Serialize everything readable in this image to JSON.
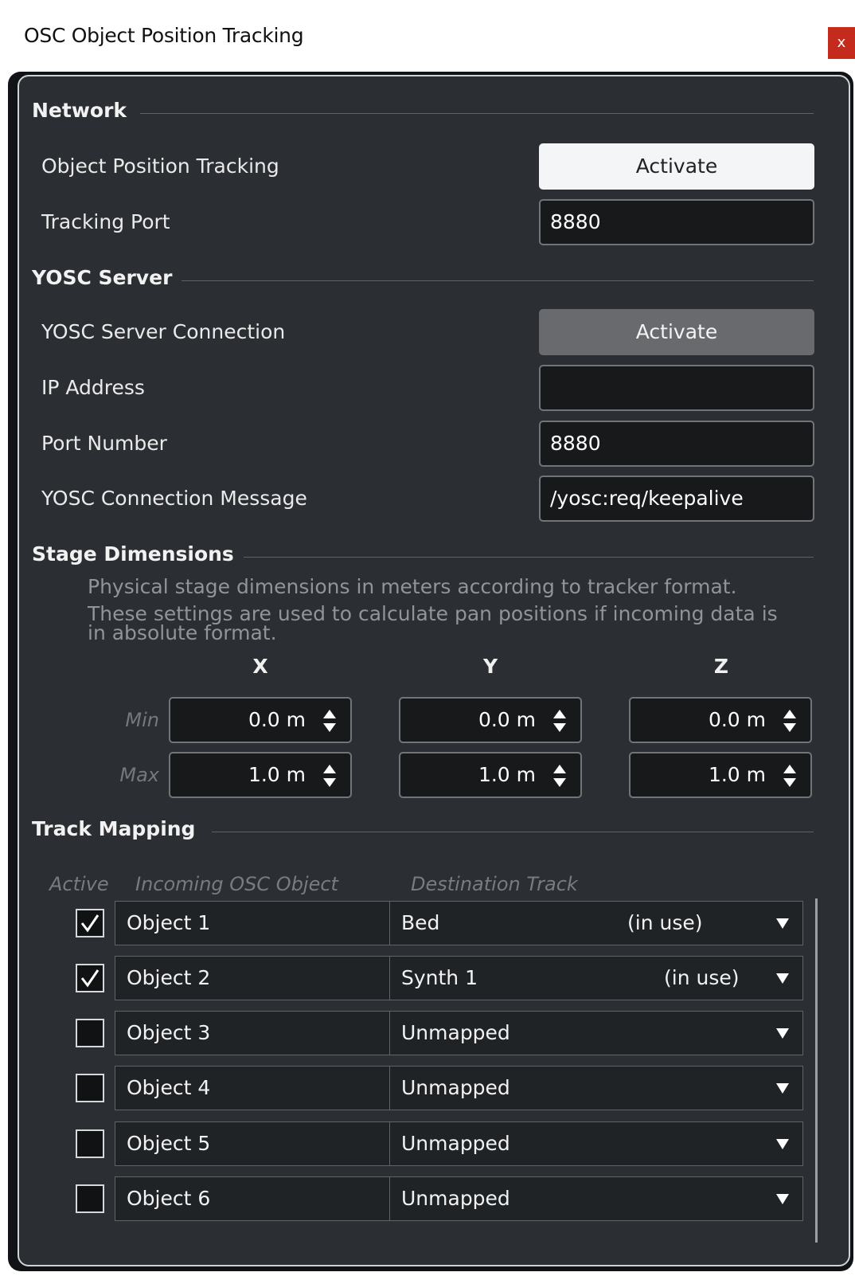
{
  "window": {
    "title": "OSC Object Position Tracking",
    "close_label": "x"
  },
  "network": {
    "heading": "Network",
    "tracking_label": "Object Position Tracking",
    "tracking_button": "Activate",
    "port_label": "Tracking Port",
    "port_value": "8880"
  },
  "yosc": {
    "heading": "YOSC Server",
    "connection_label": "YOSC Server Connection",
    "connection_button": "Activate",
    "ip_label": "IP Address",
    "ip_value": "",
    "port_label": "Port Number",
    "port_value": "8880",
    "message_label": "YOSC Connection Message",
    "message_value": "/yosc:req/keepalive"
  },
  "stage": {
    "heading": "Stage Dimensions",
    "description_1": "Physical stage dimensions in meters according to tracker format.",
    "description_2": "These settings are used to calculate pan positions if incoming data is",
    "description_3": "in absolute format.",
    "axes": [
      "X",
      "Y",
      "Z"
    ],
    "min_label": "Min",
    "max_label": "Max",
    "min_values": [
      "0.0 m",
      "0.0 m",
      "0.0 m"
    ],
    "max_values": [
      "1.0 m",
      "1.0 m",
      "1.0 m"
    ]
  },
  "mapping": {
    "heading": "Track Mapping",
    "col_active": "Active",
    "col_object": "Incoming OSC Object",
    "col_dest": "Destination Track",
    "rows": [
      {
        "checked": true,
        "object": "Object 1",
        "dest": "Bed",
        "in_use": "(in use)"
      },
      {
        "checked": true,
        "object": "Object 2",
        "dest": "Synth 1",
        "in_use": "(in use)"
      },
      {
        "checked": false,
        "object": "Object 3",
        "dest": "Unmapped",
        "in_use": ""
      },
      {
        "checked": false,
        "object": "Object 4",
        "dest": "Unmapped",
        "in_use": ""
      },
      {
        "checked": false,
        "object": "Object 5",
        "dest": "Unmapped",
        "in_use": ""
      },
      {
        "checked": false,
        "object": "Object 6",
        "dest": "Unmapped",
        "in_use": ""
      }
    ]
  },
  "colors": {
    "panel_bg": "#2b2e32",
    "field_bg": "#17191b",
    "close_red": "#c42b1c",
    "button_light": "#f4f5f6",
    "button_gray": "#686a6d"
  }
}
